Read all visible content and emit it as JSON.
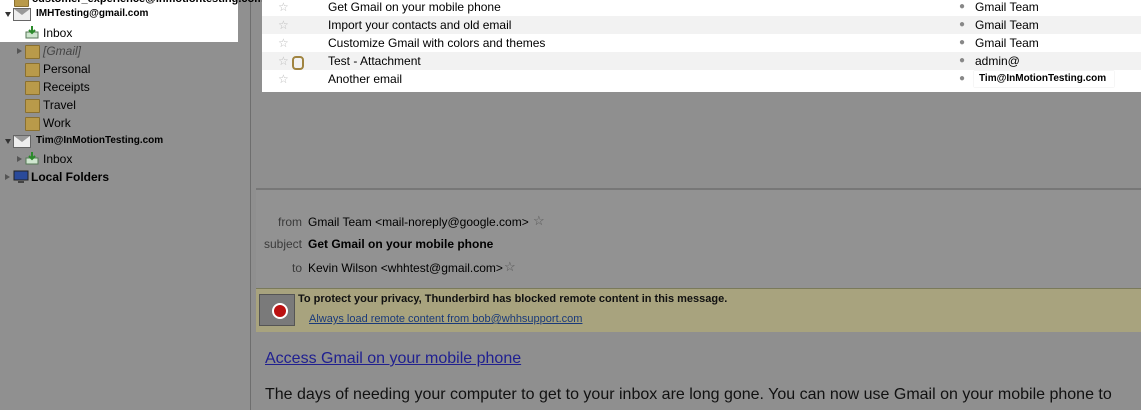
{
  "folder_pane": {
    "top_account_partial": "customer_experience@inmotiontesting.com",
    "accounts": [
      {
        "name": "IMHTesting@gmail.com",
        "folders": [
          "Inbox",
          "[Gmail]",
          "Personal",
          "Receipts",
          "Travel",
          "Work"
        ]
      },
      {
        "name": "Tim@InMotionTesting.com",
        "folders": [
          "Inbox"
        ]
      },
      {
        "name": "Local Folders",
        "folders": []
      }
    ]
  },
  "message_list": {
    "rows": [
      {
        "subject": "Get Gmail on your mobile phone",
        "sender": "Gmail Team",
        "attachment": false
      },
      {
        "subject": "Import your contacts and old email",
        "sender": "Gmail Team",
        "attachment": false
      },
      {
        "subject": "Customize Gmail with colors and themes",
        "sender": "Gmail Team",
        "attachment": false
      },
      {
        "subject": "Test - Attachment",
        "sender": "admin@",
        "attachment": true
      },
      {
        "subject": "Another email",
        "sender": "Tim@InMotionTesting.com",
        "attachment": false
      }
    ]
  },
  "header": {
    "from_label": "from",
    "from_value": "Gmail Team <mail-noreply@google.com>",
    "subject_label": "subject",
    "subject_value": "Get Gmail on your mobile phone",
    "to_label": "to",
    "to_value": "Kevin Wilson <whhtest@gmail.com>"
  },
  "notification": {
    "title": "To protect your privacy, Thunderbird has blocked remote content in this message.",
    "link": "Always load remote content from bob@whhsupport.com"
  },
  "body": {
    "title_link": "Access Gmail on your mobile phone",
    "text": "The days of needing your computer to get to your inbox are long gone. You can now use Gmail on your mobile phone to"
  },
  "colors": {
    "list_bg": "#ffffff",
    "dim_bg": "#8f8f8f",
    "notify_bg": "#a8a37e",
    "link": "#202090"
  },
  "icons": [
    "star-icon",
    "attachment-icon",
    "folder-icon",
    "inbox-icon",
    "account-icon",
    "blocked-content-icon"
  ]
}
